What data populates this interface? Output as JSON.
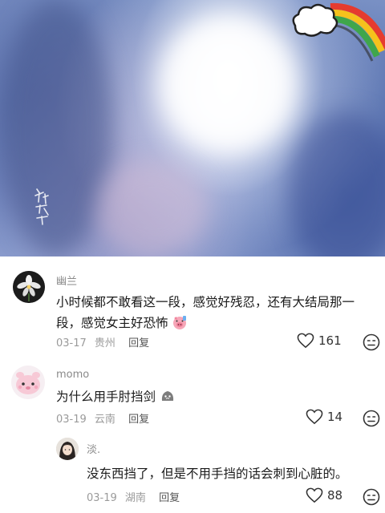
{
  "video": {
    "watermark_icon": "calligraphy-signature-icon",
    "badge_icon": "cloud-rainbow-sticker-icon"
  },
  "comments": [
    {
      "username": "幽兰",
      "avatar_icon": "orchid-flower-avatar",
      "text": "小时候都不敢看这一段，感觉好残忍，还有大结局那一段，感觉女主好恐怖",
      "emoji_icon": "pig-face-emoji-icon",
      "date": "03-17",
      "location": "贵州",
      "reply_label": "回复",
      "likes": "161"
    },
    {
      "username": "momo",
      "avatar_icon": "pink-cartoon-avatar",
      "text": "为什么用手肘挡剑",
      "emoji_icon": "grey-blob-emoji-icon",
      "date": "03-19",
      "location": "云南",
      "reply_label": "回复",
      "likes": "14"
    },
    {
      "username": "淡.",
      "avatar_icon": "girl-photo-avatar",
      "text": "没东西挡了，但是不用手挡的话会刺到心脏的。",
      "date": "03-19",
      "location": "湖南",
      "reply_label": "回复",
      "likes": "88"
    }
  ],
  "colors": {
    "username": "#8a8a8a",
    "meta": "#9a9a9a",
    "text": "#1a1a1a"
  }
}
